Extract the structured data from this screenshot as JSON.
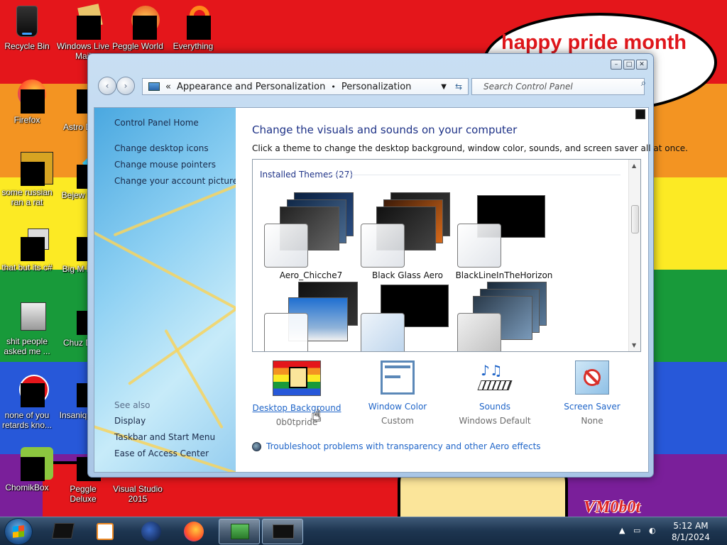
{
  "wallpaper": {
    "bubble_text": "happy pride month",
    "signature": "VM0b0t"
  },
  "desktop_icons": [
    {
      "label": "Recycle Bin"
    },
    {
      "label": "Windows Live Mail"
    },
    {
      "label": "Peggle World"
    },
    {
      "label": "Everything"
    },
    {
      "label": "Firefox"
    },
    {
      "label": "Astro Delu"
    },
    {
      "label": "some russian ran a rat"
    },
    {
      "label": "Bejew Delu"
    },
    {
      "label": "that but its c#"
    },
    {
      "label": "Big M Delu"
    },
    {
      "label": "shit people asked me ..."
    },
    {
      "label": "Chuz Delu"
    },
    {
      "label": "none of you retards kno..."
    },
    {
      "label": "Insaniq Delu"
    },
    {
      "label": "ChomikBox"
    },
    {
      "label": "Peggle Deluxe"
    },
    {
      "label": "Visual Studio 2015"
    }
  ],
  "window": {
    "breadcrumb": {
      "separator": "«",
      "items": [
        "Appearance and Personalization",
        "Personalization"
      ]
    },
    "search_placeholder": "Search Control Panel",
    "left_pane": {
      "links": [
        "Control Panel Home",
        "Change desktop icons",
        "Change mouse pointers",
        "Change your account picture"
      ],
      "see_also_label": "See also",
      "see_also_links": [
        "Display",
        "Taskbar and Start Menu",
        "Ease of Access Center"
      ]
    },
    "main": {
      "title": "Change the visuals and sounds on your computer",
      "description": "Click a theme to change the desktop background, window color, sounds, and screen saver all at once.",
      "themes_header": "Installed Themes (27)",
      "themes": [
        {
          "name": "Aero_Chicche7"
        },
        {
          "name": "Black Glass Aero"
        },
        {
          "name": "BlackLineInTheHorizon"
        },
        {
          "name": ""
        },
        {
          "name": ""
        },
        {
          "name": ""
        }
      ],
      "bottom_items": [
        {
          "label": "Desktop Background",
          "sub": "0b0tpride"
        },
        {
          "label": "Window Color",
          "sub": "Custom"
        },
        {
          "label": "Sounds",
          "sub": "Windows Default"
        },
        {
          "label": "Screen Saver",
          "sub": "None"
        }
      ],
      "troubleshoot_link": "Troubleshoot problems with transparency and other Aero effects"
    }
  },
  "taskbar": {
    "time": "5:12 AM",
    "date": "8/1/2024"
  },
  "colors": {
    "link": "#1e64c8",
    "title": "#1e3287"
  }
}
